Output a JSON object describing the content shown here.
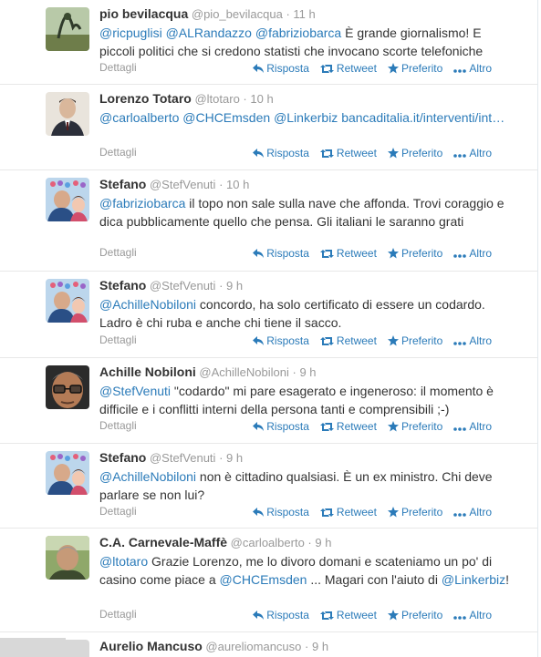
{
  "tweets": [
    {
      "fullname": "pio bevilacqua",
      "username": "@pio_bevilacqua",
      "time": "11 h",
      "segments": [
        {
          "t": "@ricpuglisi",
          "m": true
        },
        {
          "t": " "
        },
        {
          "t": "@ALRandazzo",
          "m": true
        },
        {
          "t": " "
        },
        {
          "t": "@fabriziobarca",
          "m": true
        },
        {
          "t": " È grande giornalismo! E piccoli politici che si credono statisti che invocano scorte telefoniche"
        }
      ],
      "avatar": "avatar-landscape"
    },
    {
      "fullname": "Lorenzo Totaro",
      "username": "@ltotaro",
      "time": "10 h",
      "segments": [
        {
          "t": "@carloalberto",
          "m": true
        },
        {
          "t": " "
        },
        {
          "t": "@CHCEmsden",
          "m": true
        },
        {
          "t": " "
        },
        {
          "t": "@Linkerbiz",
          "m": true
        },
        {
          "t": " "
        },
        {
          "t": "bancaditalia.it/interventi/int…",
          "m": true
        }
      ],
      "avatar": "avatar-man-suit"
    },
    {
      "fullname": "Stefano",
      "username": "@StefVenuti",
      "time": "10 h",
      "segments": [
        {
          "t": "@fabriziobarca",
          "m": true
        },
        {
          "t": " il topo non sale sulla nave che affonda. Trovi coraggio e dica pubblicamente quello che pensa. Gli italiani le saranno grati"
        }
      ],
      "avatar": "avatar-family"
    },
    {
      "fullname": "Stefano",
      "username": "@StefVenuti",
      "time": "9 h",
      "segments": [
        {
          "t": "@AchilleNobiloni",
          "m": true
        },
        {
          "t": " concordo, ha solo certificato di essere un codardo. Ladro è chi ruba e anche chi tiene il sacco."
        }
      ],
      "avatar": "avatar-family"
    },
    {
      "fullname": "Achille Nobiloni",
      "username": "@AchilleNobiloni",
      "time": "9 h",
      "segments": [
        {
          "t": "@StefVenuti",
          "m": true
        },
        {
          "t": " \"codardo\" mi pare esagerato e ingeneroso: il momento è difficile e i conflitti interni della persona tanti e comprensibili ;-)"
        }
      ],
      "avatar": "avatar-man-glasses"
    },
    {
      "fullname": "Stefano",
      "username": "@StefVenuti",
      "time": "9 h",
      "segments": [
        {
          "t": "@AchilleNobiloni",
          "m": true
        },
        {
          "t": " non è cittadino qualsiasi. È un ex ministro. Chi deve parlare se non lui?"
        }
      ],
      "avatar": "avatar-family"
    },
    {
      "fullname": "C.A. Carnevale-Maffè",
      "username": "@carloalberto",
      "time": "9 h",
      "segments": [
        {
          "t": "@ltotaro",
          "m": true
        },
        {
          "t": " Grazie Lorenzo, me lo divoro domani e scateniamo un po' di casino come piace a "
        },
        {
          "t": "@CHCEmsden",
          "m": true
        },
        {
          "t": " ... Magari con l'aiuto di "
        },
        {
          "t": "@Linkerbiz",
          "m": true
        },
        {
          "t": "!"
        }
      ],
      "avatar": "avatar-man-outdoor"
    },
    {
      "fullname": "Aurelio Mancuso",
      "username": "@aureliomancuso",
      "time": "9 h",
      "segments": [],
      "avatar": "avatar-gray"
    }
  ],
  "labels": {
    "details": "Dettagli",
    "reply": "Risposta",
    "retweet": "Retweet",
    "favorite": "Preferito",
    "more": "Altro",
    "dot": "·"
  },
  "colors": {
    "link": "#2b7bb9",
    "muted": "#999999",
    "text": "#333333",
    "divider": "#e8e8e8"
  }
}
